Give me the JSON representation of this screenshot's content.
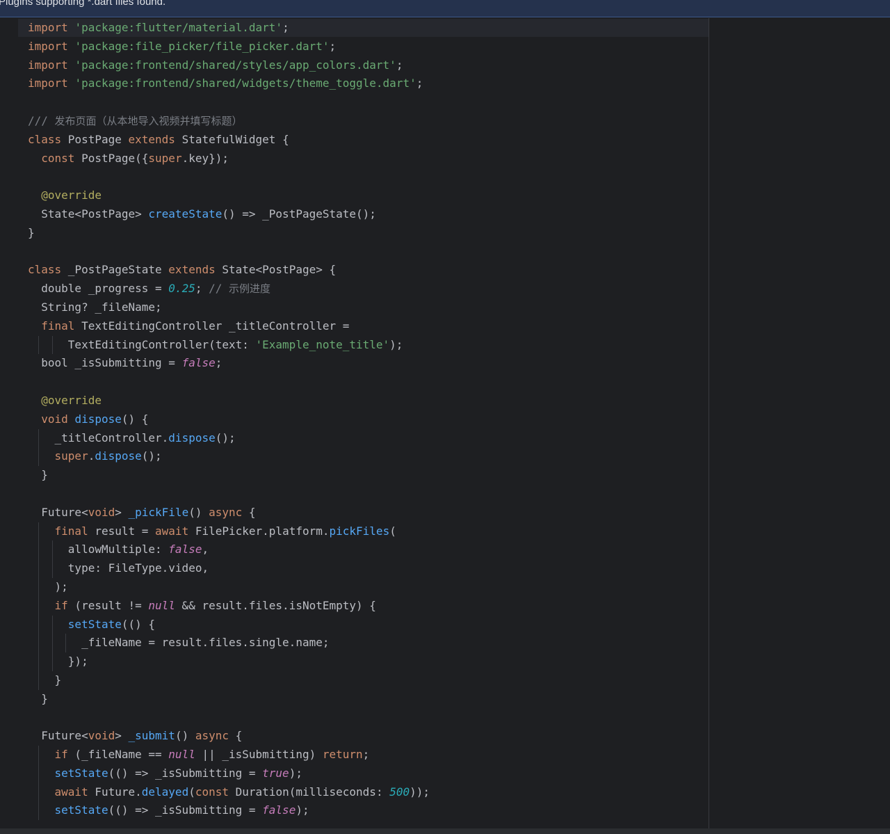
{
  "notification": {
    "text": "Plugins supporting *.dart files found."
  },
  "code": {
    "lines": [
      "import 'package:flutter/material.dart';",
      "import 'package:file_picker/file_picker.dart';",
      "import 'package:frontend/shared/styles/app_colors.dart';",
      "import 'package:frontend/shared/widgets/theme_toggle.dart';",
      "",
      "/// 发布页面（从本地导入视频并填写标题）",
      "class PostPage extends StatefulWidget {",
      "  const PostPage({super.key});",
      "",
      "  @override",
      "  State<PostPage> createState() => _PostPageState();",
      "}",
      "",
      "class _PostPageState extends State<PostPage> {",
      "  double _progress = 0.25; // 示例进度",
      "  String? _fileName;",
      "  final TextEditingController _titleController =",
      "      TextEditingController(text: 'Example_note_title');",
      "  bool _isSubmitting = false;",
      "",
      "  @override",
      "  void dispose() {",
      "    _titleController.dispose();",
      "    super.dispose();",
      "  }",
      "",
      "  Future<void> _pickFile() async {",
      "    final result = await FilePicker.platform.pickFiles(",
      "      allowMultiple: false,",
      "      type: FileType.video,",
      "    );",
      "    if (result != null && result.files.isNotEmpty) {",
      "      setState(() {",
      "        _fileName = result.files.single.name;",
      "      });",
      "    }",
      "  }",
      "",
      "  Future<void> _submit() async {",
      "    if (_fileName == null || _isSubmitting) return;",
      "    setState(() => _isSubmitting = true);",
      "    await Future.delayed(const Duration(milliseconds: 500));",
      "    setState(() => _isSubmitting = false);"
    ]
  },
  "theme": {
    "background": "#1e1f22",
    "keyword": "#cf8e6d",
    "string": "#6aab73",
    "comment": "#7a7e85",
    "annotation": "#b3ae60",
    "function": "#56a8f5",
    "number": "#2aacb8",
    "literal": "#c77dbb"
  }
}
